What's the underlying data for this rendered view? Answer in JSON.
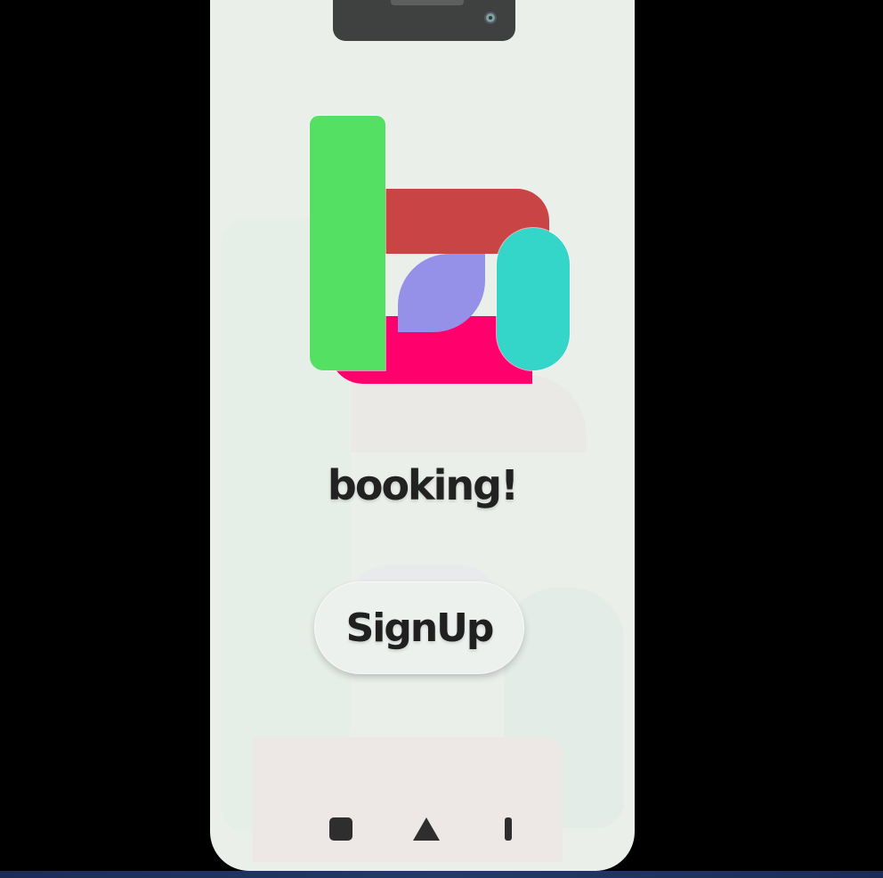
{
  "app": {
    "name": "booking!"
  },
  "main": {
    "signup_label": "SignUp"
  },
  "logo": {
    "icon": "booking-logo-icon",
    "colors": [
      "#54e063",
      "#c94444",
      "#33d6c8",
      "#9590e8",
      "#ff006d"
    ]
  },
  "navbar": {
    "icons": [
      "recent-apps-icon",
      "home-icon",
      "back-icon"
    ]
  }
}
